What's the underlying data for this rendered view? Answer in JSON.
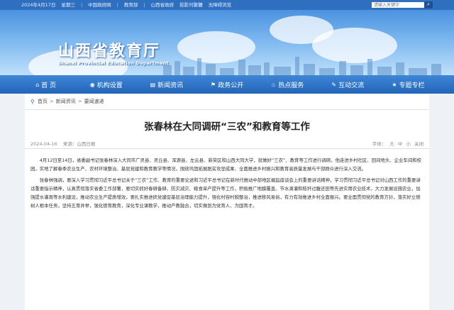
{
  "topbar": {
    "date": "2024年4月17日",
    "weekday": "星期三",
    "links": [
      "中国政府网",
      "教育部",
      "山西省政府",
      "投影刊繁體",
      "无障碍浏览"
    ],
    "search_placeholder": "请输入关键字",
    "search_button": "⌕"
  },
  "header": {
    "title": "山西省教育厅",
    "subtitle": "Shanxi Provincial Education Department"
  },
  "nav": {
    "items": [
      {
        "icon": "⌂",
        "label": "首 页"
      },
      {
        "icon": "◉",
        "label": "机构设置"
      },
      {
        "icon": "▤",
        "label": "新闻资讯"
      },
      {
        "icon": "⚑",
        "label": "政务公开"
      },
      {
        "icon": "♨",
        "label": "热点服务"
      },
      {
        "icon": "✎",
        "label": "互动交流"
      },
      {
        "icon": "★",
        "label": "专题专栏"
      }
    ]
  },
  "breadcrumb": {
    "items": [
      "首页",
      "新闻资讯",
      "要闻速递"
    ],
    "separator": ">"
  },
  "article": {
    "title": "张春林在大同调研“三农”和教育等工作",
    "date": "2024-04-16",
    "source_label": "来源：",
    "source": "山西日报",
    "font_label": "字体：",
    "font_large": "大",
    "font_medium": "中",
    "font_small": "小",
    "close": "关闭",
    "paragraphs": [
      "4月12日至14日，省委副书记张春林深入大同市广灵县、灵丘县、浑源县、左云县、新荣区和山西大同大学，就做好“三农”、教育等工作进行调研。他走进乡村社区、田间地头、企业车间和校园，实地了解春季农业生产、农村环境整治、基层党建和教育教学等情况，围绕巩固拓展脱贫攻坚成果、全面推进乡村振兴和教育高质量发展与干部群众进行深入交流。",
      "张春林强调，要深入学习贯彻习近平总书记关于“三农”工作、教育的重要论述和习近平总书记在新时代推动中部地区崛起座谈会上的重要讲话精神，学习贯彻习近平总书记对山西工作的重要讲话重要指示精神，认真贯彻落实省委工作部署，要切实抓好春耕备耕、防灾减灾、粮食单产提升等工作，积极推广地膜覆盖、节水滴灌和秸秆过腹还田等先进实用农业技术，大力发展设施农业，加强提水灌溉等水利建设，推动农业生产提质增效，要扎实推进抓党建促基层治理能力提升，强化村容村貌整治，推进移风易俗，有力有效推进乡村全面振兴。要全面贯彻党的教育方针，落实好立德树人根本任务，坚持五育并举，强化德育教育，深化专业课教学，推动产教融合，切实做到为党育人、为国育才。"
    ]
  }
}
